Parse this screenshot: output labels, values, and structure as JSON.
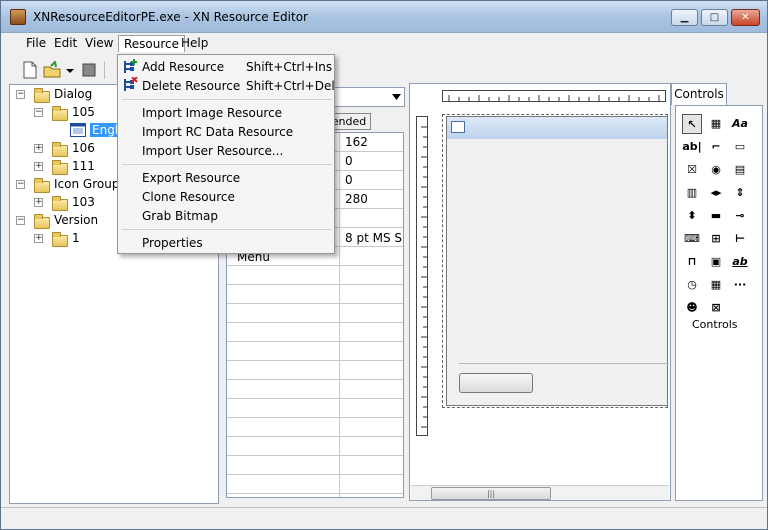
{
  "window": {
    "title": "XNResourceEditorPE.exe - XN Resource Editor"
  },
  "menubar": [
    "File",
    "Edit",
    "View",
    "Resource",
    "Help"
  ],
  "tree": {
    "dialog": "Dialog",
    "n105": "105",
    "engl": "Engl",
    "n106": "106",
    "n111": "111",
    "icongroup": "Icon Group",
    "n103": "103",
    "version": "Version",
    "n1": "1"
  },
  "context_menu": {
    "add": "Add Resource",
    "add_key": "Shift+Ctrl+Ins",
    "delete": "Delete Resource",
    "delete_key": "Shift+Ctrl+Del",
    "import_image": "Import Image Resource",
    "import_rc": "Import RC Data Resource",
    "import_user": "Import User Resource...",
    "export": "Export Resource",
    "clone": "Clone Resource",
    "grab": "Grab Bitmap",
    "properties": "Properties"
  },
  "properties": {
    "tab_extended": "ended",
    "values": [
      "162",
      "0",
      "0",
      "280",
      "",
      "8 pt MS S"
    ],
    "menu_label": "Menu"
  },
  "controls": {
    "tab": "Controls",
    "label": "Controls",
    "icons": [
      "pointer-icon",
      "picture-icon",
      "label-icon",
      "edit-icon",
      "groupbox-icon",
      "button-icon",
      "checkbox-icon",
      "radio-icon",
      "combobox-icon",
      "listbox-icon",
      "hscroll-icon",
      "vscroll-icon",
      "updown-icon",
      "progress-icon",
      "slider-icon",
      "hotkey-icon",
      "listview-icon",
      "treeview-icon",
      "tab-icon",
      "animate-icon",
      "richedit-icon",
      "datetime-icon",
      "monthcal-icon",
      "ipaddress-icon",
      "custom-icon",
      "combobox-ex-icon"
    ]
  }
}
